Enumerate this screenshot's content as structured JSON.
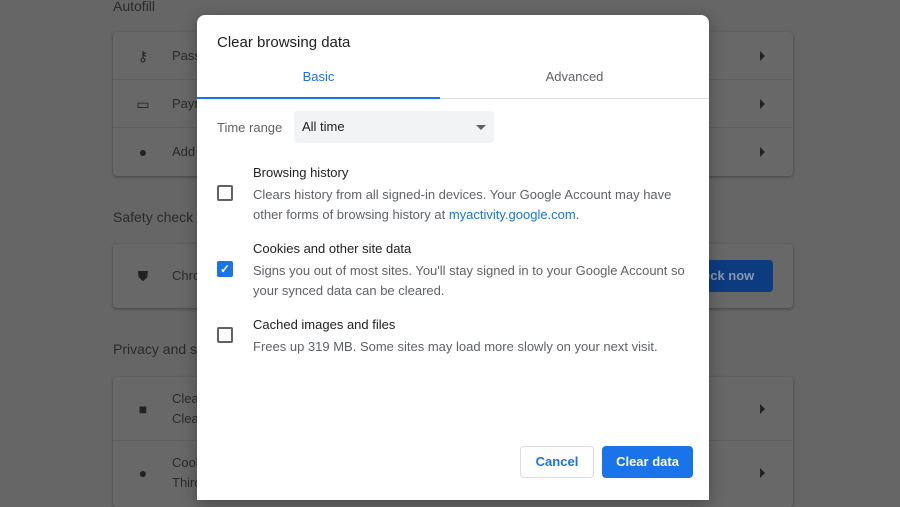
{
  "background": {
    "sections": [
      "Autofill",
      "Safety check",
      "Privacy and s"
    ],
    "autofill_rows": [
      {
        "icon": "key-icon",
        "label": "Pass"
      },
      {
        "icon": "credit-card-icon",
        "label": "Payr"
      },
      {
        "icon": "location-pin-icon",
        "label": "Add"
      }
    ],
    "safety_row": {
      "label": "Chro",
      "button": "eck now"
    },
    "privacy_rows": [
      {
        "icon": "trash-icon",
        "label": "Clear",
        "sub": "Clear"
      },
      {
        "icon": "cookie-icon",
        "label": "Cook",
        "sub": "Third"
      }
    ]
  },
  "dialog": {
    "title": "Clear browsing data",
    "tabs": [
      {
        "label": "Basic",
        "active": true
      },
      {
        "label": "Advanced",
        "active": false
      }
    ],
    "time_range_label": "Time range",
    "time_range_value": "All time",
    "options": [
      {
        "title": "Browsing history",
        "desc": "Clears history from all signed-in devices. Your Google Account may have other forms of browsing history at ",
        "link": "myactivity.google.com",
        "desc_end": ".",
        "checked": false
      },
      {
        "title": "Cookies and other site data",
        "desc": "Signs you out of most sites. You'll stay signed in to your Google Account so your synced data can be cleared.",
        "checked": true
      },
      {
        "title": "Cached images and files",
        "desc": "Frees up 319 MB. Some sites may load more slowly on your next visit.",
        "checked": false
      }
    ],
    "cancel": "Cancel",
    "clear": "Clear data",
    "accent": "#1a73e8"
  }
}
